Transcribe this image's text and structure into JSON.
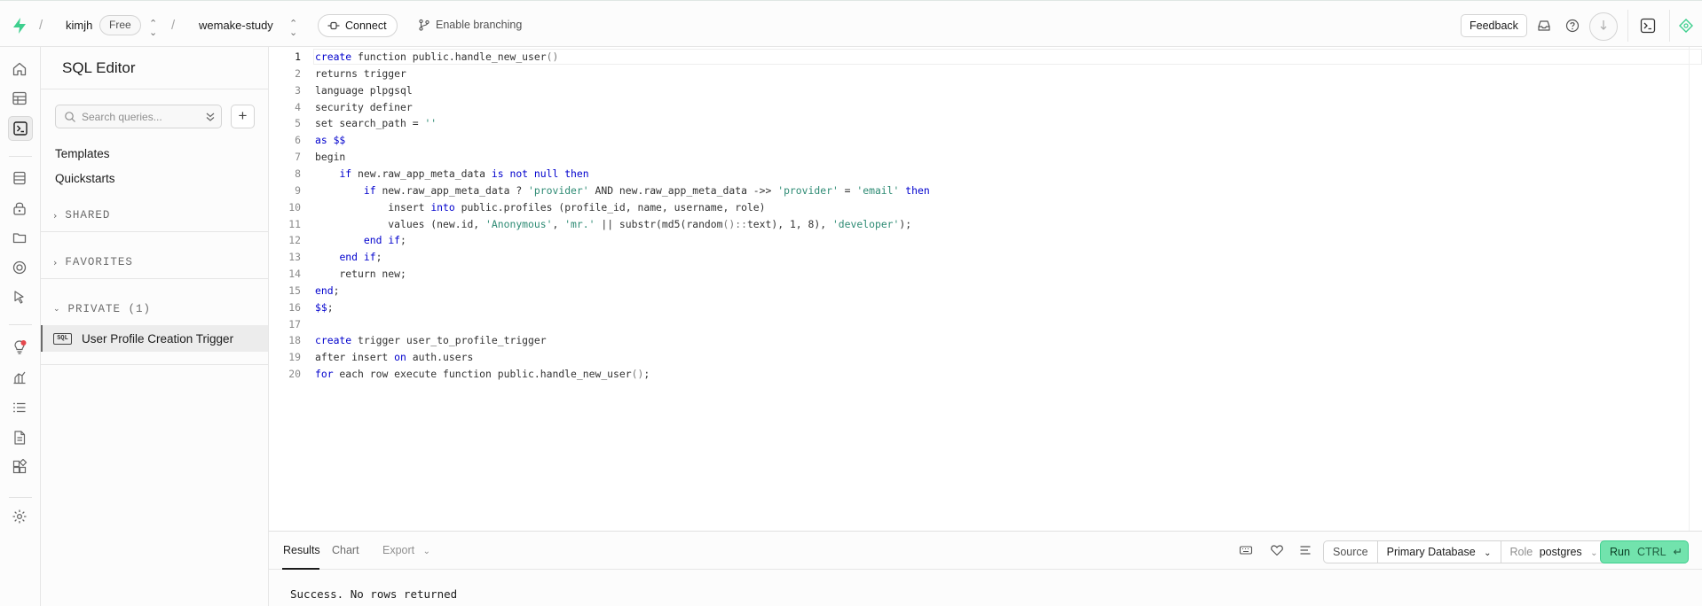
{
  "topbar": {
    "org_name": "kimjh",
    "plan_badge": "Free",
    "project_name": "wemake-study",
    "connect_label": "Connect",
    "branching_label": "Enable branching",
    "feedback_label": "Feedback",
    "separator": "/"
  },
  "rail": {
    "icons": [
      "home-icon",
      "table-editor-icon",
      "sql-editor-icon",
      "database-icon",
      "auth-icon",
      "storage-icon",
      "realtime-icon",
      "edge-functions-icon",
      "advisors-icon",
      "reports-icon",
      "logs-icon",
      "api-docs-icon",
      "integrations-icon",
      "settings-icon"
    ]
  },
  "sidebar": {
    "title": "SQL Editor",
    "search_placeholder": "Search queries...",
    "add_label": "+",
    "templates_label": "Templates",
    "quickstarts_label": "Quickstarts",
    "shared_label": "SHARED",
    "favorites_label": "FAVORITES",
    "private_label": "PRIVATE (1)",
    "query_tag": "SQL",
    "query_name": "User Profile Creation Trigger"
  },
  "editor": {
    "active_line": 1,
    "line_numbers": [
      "1",
      "2",
      "3",
      "4",
      "5",
      "6",
      "7",
      "8",
      "9",
      "10",
      "11",
      "12",
      "13",
      "14",
      "15",
      "16",
      "17",
      "18",
      "19",
      "20"
    ],
    "lines": [
      "create function public.handle_new_user()",
      "returns trigger",
      "language plpgsql",
      "security definer",
      "set search_path = ''",
      "as $$",
      "begin",
      "    if new.raw_app_meta_data is not null then",
      "        if new.raw_app_meta_data ? 'provider' AND new.raw_app_meta_data ->> 'provider' = 'email' then",
      "            insert into public.profiles (profile_id, name, username, role)",
      "            values (new.id, 'Anonymous', 'mr.' || substr(md5(random()::text), 1, 8), 'developer');",
      "        end if;",
      "    end if;",
      "    return new;",
      "end;",
      "$$;",
      "",
      "create trigger user_to_profile_trigger",
      "after insert on auth.users",
      "for each row execute function public.handle_new_user();"
    ]
  },
  "results": {
    "tab_results": "Results",
    "tab_chart": "Chart",
    "tab_export": "Export",
    "source_label": "Source",
    "database_label": "Primary Database",
    "role_prefix": "Role",
    "role_value": "postgres",
    "run_label": "Run",
    "run_shortcut": "CTRL",
    "message": "Success. No rows returned"
  },
  "colors": {
    "brand_green": "#3ecf8e",
    "run_button": "#72e3ad",
    "keyword": "#0000cd",
    "string": "#2e8b74"
  }
}
